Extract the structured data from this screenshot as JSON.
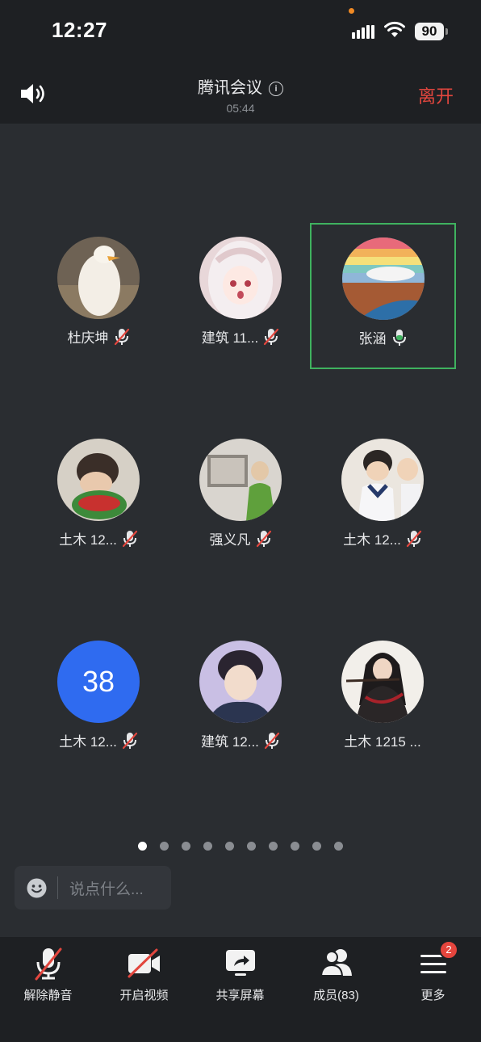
{
  "status": {
    "time": "12:27",
    "battery": "90"
  },
  "header": {
    "title": "腾讯会议",
    "duration": "05:44",
    "leave_label": "离开"
  },
  "participants": [
    {
      "name": "杜庆坤",
      "mic": "muted"
    },
    {
      "name": "建筑 11...",
      "mic": "muted"
    },
    {
      "name": "张涵",
      "mic": "active"
    },
    {
      "name": "土木 12...",
      "mic": "muted"
    },
    {
      "name": "强义凡",
      "mic": "muted"
    },
    {
      "name": "土木 12...",
      "mic": "muted"
    },
    {
      "name": "土木 12...",
      "mic": "muted",
      "avatar_text": "38"
    },
    {
      "name": "建筑 12...",
      "mic": "muted"
    },
    {
      "name": "土木 1215 ...",
      "mic": "none"
    }
  ],
  "pagination": {
    "total": 10,
    "current": 1
  },
  "chat": {
    "placeholder": "说点什么..."
  },
  "toolbar": {
    "unmute": "解除静音",
    "video": "开启视频",
    "share": "共享屏幕",
    "members": "成员(83)",
    "more": "更多",
    "more_badge": "2"
  },
  "colors": {
    "leave": "#e2463e",
    "speaking_border": "#3fb25f",
    "avatar_number_bg": "#2f6bf0",
    "badge": "#e5453d"
  }
}
